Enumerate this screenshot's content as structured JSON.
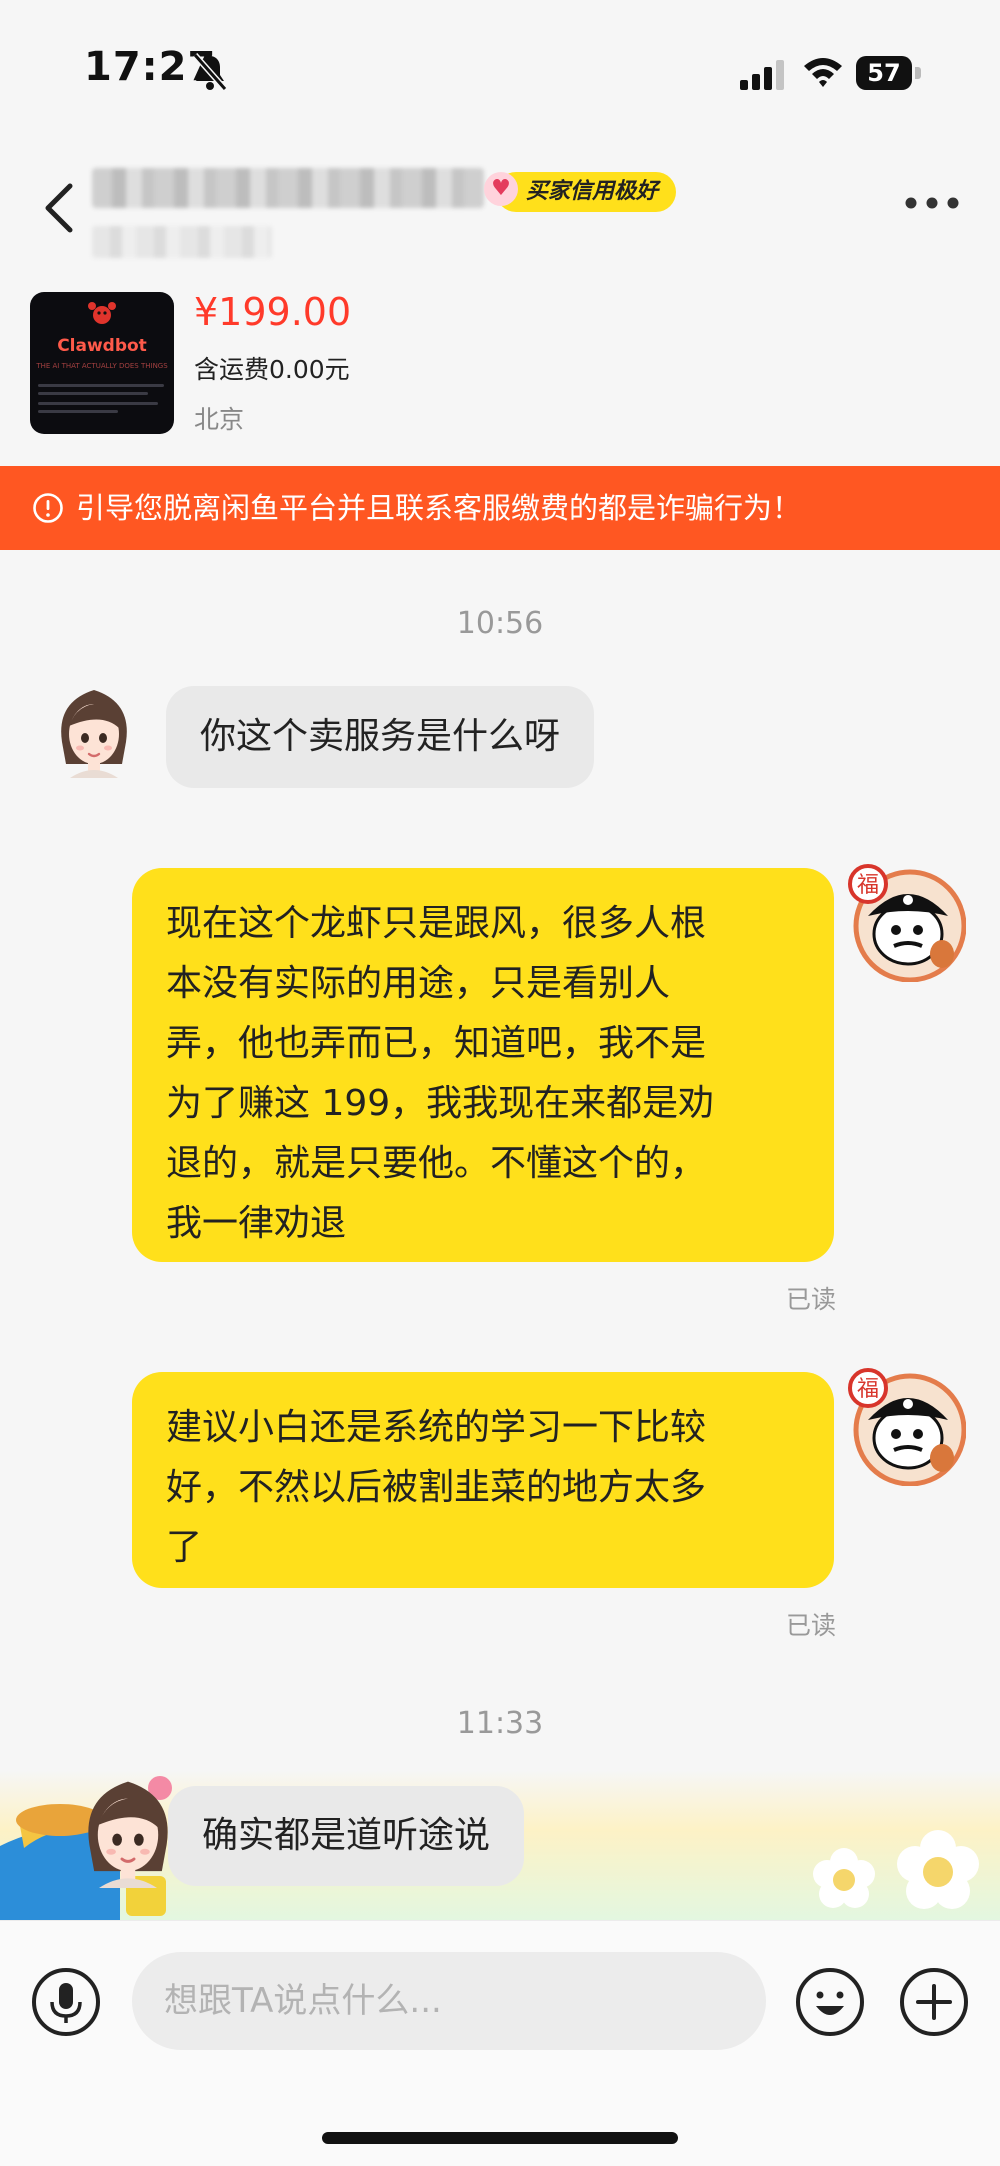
{
  "status_bar": {
    "time": "17:27",
    "battery": "57"
  },
  "header": {
    "seller_badge": "买家信用极好"
  },
  "product": {
    "thumb_title": "Clawdbot",
    "thumb_subtitle": "THE AI THAT ACTUALLY DOES THINGS",
    "price": "¥199.00",
    "shipping": "含运费0.00元",
    "location": "北京"
  },
  "warning": {
    "text": "引导您脱离闲鱼平台并且联系客服缴费的都是诈骗行为！"
  },
  "messages": [
    {
      "time": "10:56"
    },
    {
      "side": "left",
      "text": "你这个卖服务是什么呀"
    },
    {
      "side": "right",
      "lines": [
        "现在这个龙虾只是跟风，很多人根",
        "本没有实际的用途，只是看别人",
        "弄，他也弄而已，知道吧，我不是",
        "为了赚这 199，我我现在来都是劝",
        "退的，就是只要他。不懂这个的，",
        "我一律劝退"
      ],
      "status": "已读"
    },
    {
      "side": "right",
      "lines": [
        "建议小白还是系统的学习一下比较",
        "好，不然以后被割韭菜的地方太多",
        "了"
      ],
      "status": "已读"
    },
    {
      "time": "11:33"
    },
    {
      "side": "left",
      "text": "确实都是道听途说"
    }
  ],
  "pirate_badge": "福",
  "input": {
    "placeholder": "想跟TA说点什么..."
  },
  "colors": {
    "accent_yellow": "#ffe01b",
    "warning_orange": "#ff5722",
    "price_red": "#ff3a2a"
  }
}
